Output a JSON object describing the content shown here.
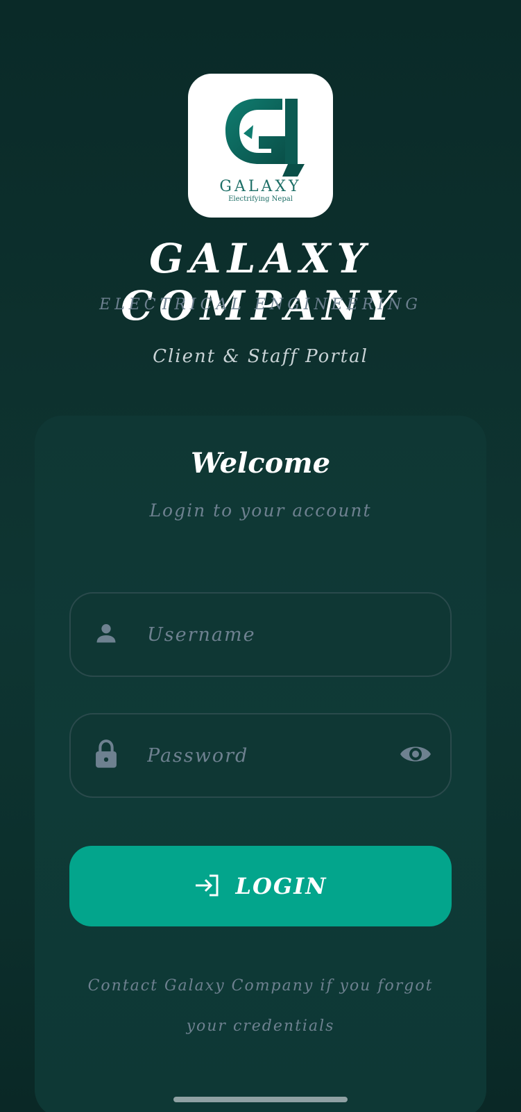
{
  "logo": {
    "word": "GALAXY",
    "tagline": "Electrifying Nepal"
  },
  "brand": {
    "title": "GALAXY COMPANY",
    "subtitle": "ELECTRICAL ENGINEERING",
    "portal": "Client & Staff Portal"
  },
  "card": {
    "title": "Welcome",
    "subtitle": "Login to your account"
  },
  "fields": {
    "username": {
      "placeholder": "Username",
      "value": "",
      "icon": "person-icon"
    },
    "password": {
      "placeholder": "Password",
      "value": "",
      "icon": "lock-icon",
      "toggle_icon": "eye-icon"
    }
  },
  "login_button": {
    "label": "LOGIN",
    "icon": "login-icon"
  },
  "help_text": "Contact Galaxy Company if you forgot your credentials",
  "colors": {
    "accent": "#03a58c",
    "background": "#0d302d",
    "muted": "#6e8190"
  }
}
